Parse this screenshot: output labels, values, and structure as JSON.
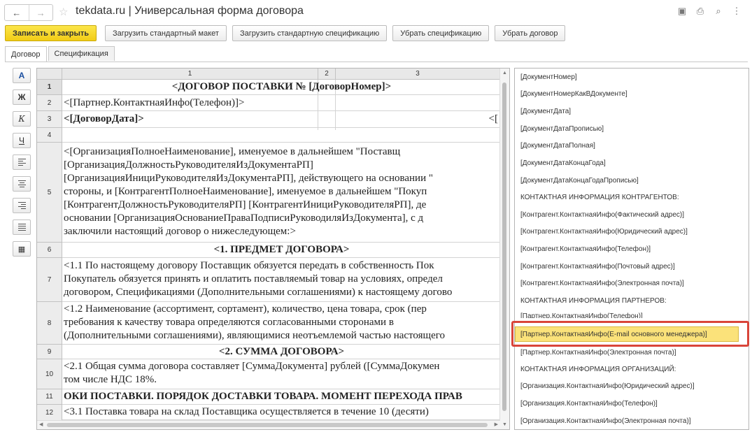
{
  "window": {
    "title": "tekdata.ru | Универсальная форма договора",
    "nav_back": "←",
    "nav_forward": "→",
    "favorite_icon": "star-icon",
    "tools": [
      "save-icon",
      "print-icon",
      "preview-icon",
      "more-icon"
    ]
  },
  "toolbar": {
    "save_close": "Записать и закрыть",
    "load_template": "Загрузить стандартный макет",
    "load_spec": "Загрузить стандартную спецификацию",
    "remove_spec": "Убрать спецификацию",
    "remove_contract": "Убрать договор"
  },
  "tabs": [
    "Договор",
    "Спецификация"
  ],
  "format_toolbar": {
    "font_color": "A",
    "bold": "Ж",
    "italic": "К",
    "underline": "Ч"
  },
  "sheet": {
    "columns": [
      "1",
      "2",
      "3"
    ],
    "rows": [
      {
        "num": "1",
        "lines": [
          "<ДОГОВОР ПОСТАВКИ №  [ДоговорНомер]>"
        ]
      },
      {
        "num": "2",
        "lines": [
          "<[Партнер.КонтактнаяИнфо(Телефон)]>"
        ]
      },
      {
        "num": "3",
        "lines": [
          "<[ДоговорДата]>"
        ],
        "right": "<["
      },
      {
        "num": "4",
        "lines": [
          ""
        ]
      },
      {
        "num": "5",
        "lines": [
          "<[ОрганизацияПолноеНаименование],   именуемое   в   дальнейшем   \"Поставщ",
          "[ОрганизацияДолжностьРуководителяИзДокументаРП]",
          "[ОрганизацияИнициРуководителяИзДокументаРП],   действующего   на   основании   \"",
          "стороны, и [КонтрагентПолноеНаименование], именуемое в дальнейшем \"Покуп",
          "[КонтрагентДолжностьРуководителяРП]        [КонтрагентИнициРуководителяРП],        де",
          "основании   [ОрганизацияОснованиеПраваПодписиРуководиляИзДокумента],   с   д",
          "заключили настоящий договор о нижеследующем:>"
        ]
      },
      {
        "num": "6",
        "lines": [
          "<1. ПРЕДМЕТ ДОГОВОРА>"
        ]
      },
      {
        "num": "7",
        "lines": [
          "<1.1 По настоящему договору Поставщик обязуется передать в собственность Пок",
          "Покупатель обязуется принять и оплатить поставляемый товар на условиях, определ",
          "договором, Спецификациями (Дополнительными соглашениями) к настоящему догово"
        ]
      },
      {
        "num": "8",
        "lines": [
          "<1.2 Наименование (ассортимент, сортамент), количество, цена товара, срок (пер",
          "требования  к  качеству  товара  определяются     согласованными  сторонами  в",
          "(Дополнительными соглашениями), являющимися неотъемлемой частью настоящего"
        ]
      },
      {
        "num": "9",
        "lines": [
          "<2.  СУММА ДОГОВОРА>"
        ]
      },
      {
        "num": "10",
        "lines": [
          "<2.1 Общая сумма договора составляет [СуммаДокумента] рублей ([СуммаДокумен",
          "том числе НДС 18%."
        ]
      },
      {
        "num": "11",
        "lines": [
          "ОКИ ПОСТАВКИ. ПОРЯДОК ДОСТАВКИ ТОВАРА. МОМЕНТ ПЕРЕХОДА ПРАВ"
        ]
      },
      {
        "num": "12",
        "lines": [
          "<3.1 Поставка товара на склад Поставщика осуществляется в течение 10 (десяти)"
        ]
      }
    ]
  },
  "fields": [
    "[ДокументНомер]",
    "[ДокументНомерКакВДокументе]",
    "[ДокументДата]",
    "[ДокументДатаПрописью]",
    "[ДокументДатаПолная]",
    "[ДокументДатаКонцаГода]",
    "[ДокументДатаКонцаГодаПрописью]",
    "КОНТАКТНАЯ ИНФОРМАЦИЯ КОНТРАГЕНТОВ:",
    "[Контрагент.КонтактнаяИнфо(Фактический адрес)]",
    "[Контрагент.КонтактнаяИнфо(Юридический адрес)]",
    "[Контрагент.КонтактнаяИнфо(Телефон)]",
    "[Контрагент.КонтактнаяИнфо(Почтовый адрес)]",
    "[Контрагент.КонтактнаяИнфо(Электронная почта)]",
    "КОНТАКТНАЯ ИНФОРМАЦИЯ ПАРТНЕРОВ:",
    "[Партнер.КонтактнаяИнфо(Телефон)]",
    "[Партнер.КонтактнаяИнфо(E-mail основного менеджера)]",
    "[Партнер.КонтактнаяИнфо(Электронная почта)]",
    "КОНТАКТНАЯ ИНФОРМАЦИЯ ОРГАНИЗАЦИЙ:",
    "[Организация.КонтактнаяИнфо(Юридический адрес)]",
    "[Организация.КонтактнаяИнфо(Телефон)]",
    "[Организация.КонтактнаяИнфо(Электронная почта)]"
  ],
  "selected_field_index": 15,
  "colors": {
    "primary_button": "#f2cc16",
    "highlight": "#fbe27a",
    "callout": "#d9453a"
  }
}
